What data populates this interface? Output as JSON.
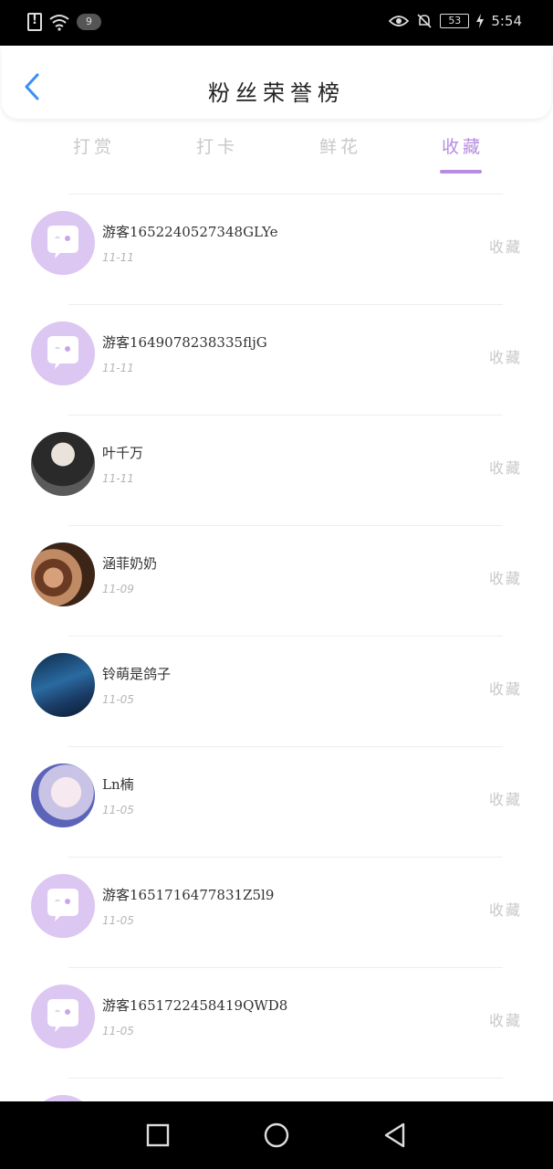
{
  "status_bar": {
    "badge": "9",
    "battery": "53",
    "time": "5:54"
  },
  "header": {
    "title": "粉丝荣誉榜"
  },
  "tabs": [
    {
      "label": "打赏",
      "active": false
    },
    {
      "label": "打卡",
      "active": false
    },
    {
      "label": "鲜花",
      "active": false
    },
    {
      "label": "收藏",
      "active": true
    }
  ],
  "fans": [
    {
      "name": "游客1652240527348GLYe",
      "date": "11-11",
      "action": "收藏",
      "avatar": "default-avatar"
    },
    {
      "name": "游客1649078238335fljG",
      "date": "11-11",
      "action": "收藏",
      "avatar": "default-avatar"
    },
    {
      "name": "叶千万",
      "date": "11-11",
      "action": "收藏",
      "avatar": "photo"
    },
    {
      "name": "涵菲奶奶",
      "date": "11-09",
      "action": "收藏",
      "avatar": "photo"
    },
    {
      "name": "铃萌是鸽子",
      "date": "11-05",
      "action": "收藏",
      "avatar": "photo"
    },
    {
      "name": "Ln楠",
      "date": "11-05",
      "action": "收藏",
      "avatar": "photo"
    },
    {
      "name": "游客1651716477831Z5l9",
      "date": "11-05",
      "action": "收藏",
      "avatar": "default-avatar"
    },
    {
      "name": "游客1651722458419QWD8",
      "date": "11-05",
      "action": "收藏",
      "avatar": "default-avatar"
    }
  ],
  "colors": {
    "accent": "#b78de0",
    "avatar_bg": "#dcc6f2",
    "back_arrow": "#3a8ef6"
  }
}
